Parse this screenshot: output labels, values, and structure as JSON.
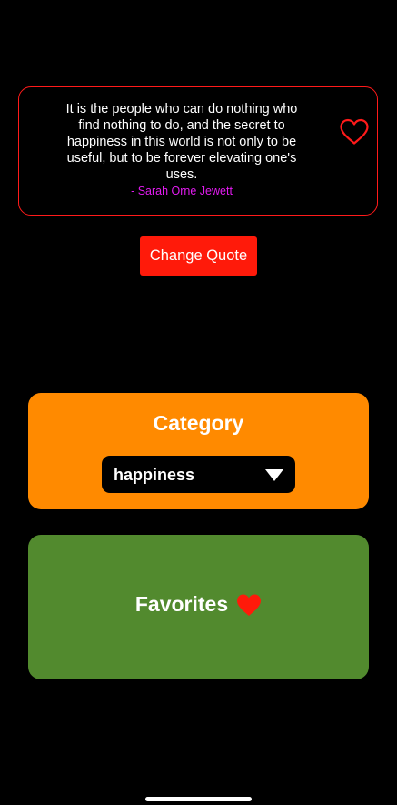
{
  "quote": {
    "text": "It is the people who can do nothing who find nothing to do, and the secret to happiness in this world is not only to be useful, but to be forever elevating one's uses.",
    "author": "- Sarah Orne Jewett",
    "favorite_icon": "heart-outline-icon",
    "is_favorite": false
  },
  "actions": {
    "change_quote_label": "Change Quote"
  },
  "category": {
    "title": "Category",
    "selected": "happiness",
    "dropdown_icon": "triangle-down-icon"
  },
  "favorites": {
    "label": "Favorites",
    "icon": "heart-filled-icon"
  },
  "colors": {
    "background": "#000000",
    "quote_border": "#ff1a1a",
    "author": "#e21bf0",
    "change_button": "#ff1a0a",
    "category_card": "#ff8a00",
    "favorites_card": "#528a2e",
    "heart": "#ff1a0a"
  }
}
